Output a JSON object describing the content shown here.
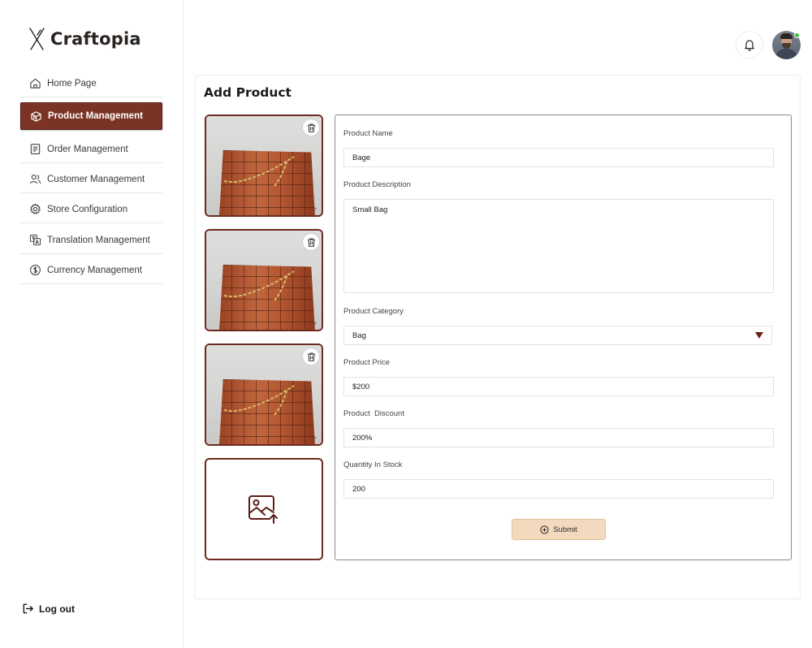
{
  "app": {
    "name": "Craftopia"
  },
  "sidebar": {
    "items": [
      {
        "label": "Home Page",
        "icon": "home-icon"
      },
      {
        "label": "Product Management",
        "icon": "product-box-icon",
        "active": true
      },
      {
        "label": "Order Management",
        "icon": "order-list-icon"
      },
      {
        "label": "Customer Management",
        "icon": "customers-icon"
      },
      {
        "label": "Store Configuration",
        "icon": "gear-icon"
      },
      {
        "label": "Translation Management",
        "icon": "translate-icon"
      },
      {
        "label": "Currency Management",
        "icon": "currency-icon"
      }
    ],
    "logout_label": "Log out"
  },
  "header": {
    "notification_icon": "bell-icon",
    "user_status": "online"
  },
  "page": {
    "title": "Add Product"
  },
  "images": {
    "thumbnails": [
      {
        "subject": "brown woven leather bag with gold chain"
      },
      {
        "subject": "brown woven leather bag with gold chain"
      },
      {
        "subject": "brown woven leather bag with gold chain"
      }
    ],
    "upload_icon": "image-upload-icon",
    "delete_icon": "trash-icon"
  },
  "form": {
    "name": {
      "label": "Product Name",
      "value": "Bage"
    },
    "description": {
      "label": "Product Description",
      "value": "Small Bag"
    },
    "category": {
      "label": "Product Category",
      "value": "Bag"
    },
    "price": {
      "label": "Product Price",
      "value": "$200"
    },
    "discount": {
      "label": "Product  Discount",
      "value": "200%"
    },
    "quantity": {
      "label": "Quantity In Stock",
      "value": "200"
    },
    "submit_label": "Submit"
  },
  "colors": {
    "brand": "#7b3424",
    "brand_border": "#4e1c12",
    "submit_bg": "#f3d9bd",
    "online": "#3cc13b"
  }
}
